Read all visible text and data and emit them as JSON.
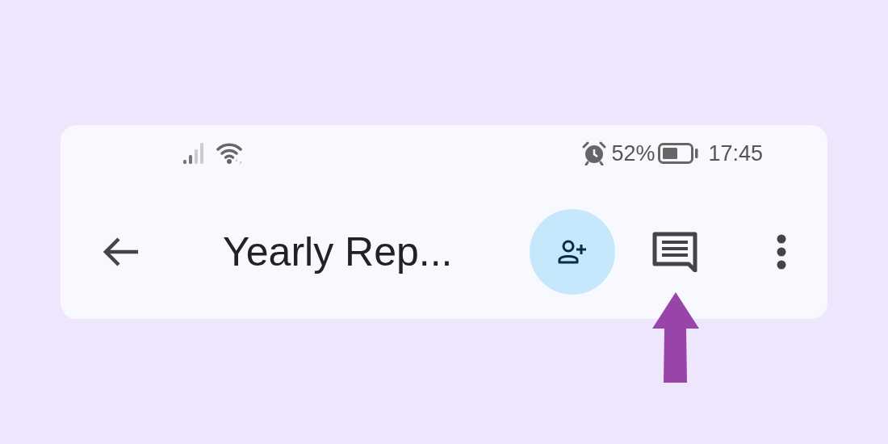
{
  "status_bar": {
    "battery": "52%",
    "time": "17:45"
  },
  "toolbar": {
    "title": "Yearly Rep..."
  }
}
